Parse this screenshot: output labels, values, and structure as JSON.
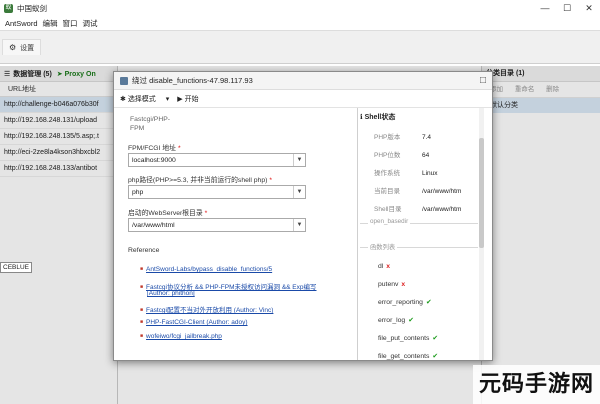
{
  "window": {
    "title": "中国蚁剑",
    "icon": "antsword-logo-icon",
    "controls": [
      "—",
      "☐",
      "✕"
    ]
  },
  "menubar": {
    "items": [
      "AntSword",
      "编辑",
      "窗口",
      "调试"
    ]
  },
  "toolbar": {
    "settings_tab": "设置",
    "settings_icon": "gear-icon"
  },
  "data_panel": {
    "title": "数据管理 (5)",
    "proxy_label": "Proxy On",
    "column_header": "URL地址",
    "rows": [
      "http://challenge-b046a076b30f",
      "http://192.168.248.131/upload",
      "http://192.168.248.135/5.asp;.t",
      "http://eci-2ze8la4kson3hbxcbl2",
      "http://192.168.248.133/antibot"
    ],
    "tooltip": "CEBLUE"
  },
  "category_panel": {
    "title": "分类目录 (1)",
    "tools": [
      "添加",
      "重命名",
      "删除"
    ],
    "items": [
      "默认分类"
    ]
  },
  "dialog": {
    "title": "绕过 disable_functions-47.98.117.93",
    "tools": {
      "mode_label": "选择模式",
      "start_label": "开始"
    },
    "left": {
      "mode_title_line1": "Fastcgi/PHP-",
      "mode_title_line2": "FPM",
      "fpm_label": "FPM/FCGI 地址",
      "fpm_value": "localhost:9000",
      "php_label": "php路径(PHP>=5.3, 并非当前运行的shell php)",
      "php_value": "php",
      "webroot_label": "启动的WebServer根目录",
      "webroot_value": "/var/www/html",
      "reference_title": "Reference",
      "references": [
        "AntSword-Labs/bypass_disable_functions/5",
        "Fastcgi协议分析 && PHP-FPM未授权访问漏洞 && Exp编写",
        "[Author: phithon]",
        "Fastcgi配置不当对外开放利用 (Author: Vinc)",
        "PHP-FastCGI-Client (Author: adoy)",
        "wofeiwo/fcgi_jailbreak.php"
      ]
    },
    "right": {
      "shell_status_title": "Shell状态",
      "info": [
        {
          "key": "PHP版本",
          "value": "7.4"
        },
        {
          "key": "PHP位数",
          "value": "64"
        },
        {
          "key": "操作系统",
          "value": "Linux"
        },
        {
          "key": "当前目录",
          "value": "/var/www/htm"
        },
        {
          "key": "Shell目录",
          "value": "/var/www/htm"
        }
      ],
      "section_basedir": "open_basedir",
      "section_functions": "函数列表",
      "functions": [
        {
          "name": "dl",
          "status": "x"
        },
        {
          "name": "putenv",
          "status": "x"
        },
        {
          "name": "error_reporting",
          "status": "✔"
        },
        {
          "name": "error_log",
          "status": "✔"
        },
        {
          "name": "file_put_contents",
          "status": "✔"
        },
        {
          "name": "file_get_contents",
          "status": "✔"
        }
      ]
    }
  },
  "watermark": "元码手游网"
}
